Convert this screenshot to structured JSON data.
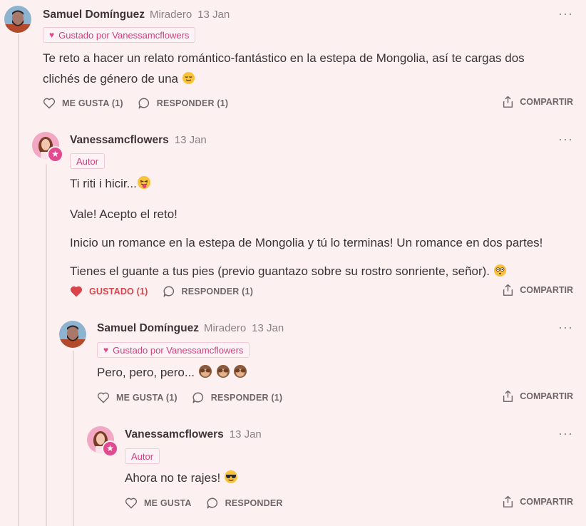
{
  "comments": [
    {
      "author": "Samuel Domínguez",
      "role": "Miradero",
      "date": "13 Jan",
      "more": "···",
      "badge": "Gustado por Vanessamcflowers",
      "lines": [
        "Te reto a hacer un relato romántico-fantástico en la estepa de Mongolia, así te cargas dos",
        "clichés de género de una"
      ],
      "like_label": "ME GUSTA (1)",
      "reply_label": "RESPONDER (1)",
      "share_label": "COMPARTIR"
    },
    {
      "author": "Vanessamcflowers",
      "date": "13 Jan",
      "more": "···",
      "author_tag": "Autor",
      "paragraphs": [
        "Ti riti i hicir...",
        "Vale! Acepto el reto!",
        "Inicio un romance en la estepa de Mongolia y tú lo terminas! Un romance en dos partes!",
        "Tienes el guante a tus pies (previo guantazo sobre su rostro sonriente, señor)."
      ],
      "like_label": "GUSTADO (1)",
      "reply_label": "RESPONDER (1)",
      "share_label": "COMPARTIR"
    },
    {
      "author": "Samuel Domínguez",
      "role": "Miradero",
      "date": "13 Jan",
      "more": "···",
      "badge": "Gustado por Vanessamcflowers",
      "text": "Pero, pero, pero...",
      "like_label": "ME GUSTA (1)",
      "reply_label": "RESPONDER (1)",
      "share_label": "COMPARTIR"
    },
    {
      "author": "Vanessamcflowers",
      "date": "13 Jan",
      "more": "···",
      "author_tag": "Autor",
      "text": "Ahora no te rajes!",
      "like_label": "ME GUSTA",
      "reply_label": "RESPONDER",
      "share_label": "COMPARTIR"
    }
  ],
  "colors": {
    "accent": "#e14a8f",
    "liked": "#d9434a",
    "background": "#fdf0f1"
  }
}
